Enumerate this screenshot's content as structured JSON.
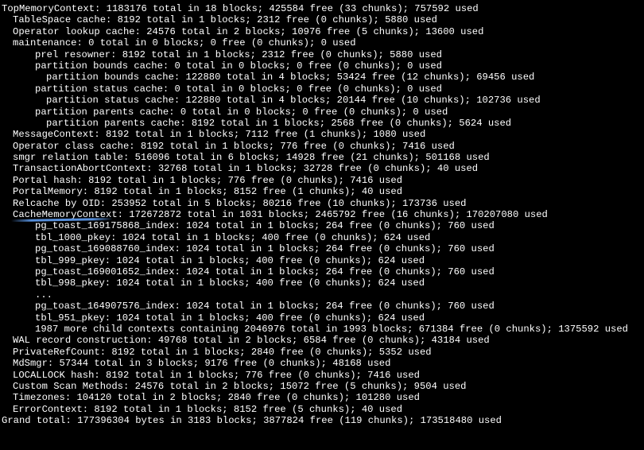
{
  "lines": [
    {
      "indent": 0,
      "text": "TopMemoryContext: 1183176 total in 18 blocks; 425584 free (33 chunks); 757592 used"
    },
    {
      "indent": 1,
      "text": "TableSpace cache: 8192 total in 1 blocks; 2312 free (0 chunks); 5880 used"
    },
    {
      "indent": 1,
      "text": "Operator lookup cache: 24576 total in 2 blocks; 10976 free (5 chunks); 13600 used"
    },
    {
      "indent": 1,
      "text": "maintenance: 0 total in 0 blocks; 0 free (0 chunks); 0 used"
    },
    {
      "indent": 3,
      "text": "prel resowner: 8192 total in 1 blocks; 2312 free (0 chunks); 5880 used"
    },
    {
      "indent": 3,
      "text": "partition bounds cache: 0 total in 0 blocks; 0 free (0 chunks); 0 used"
    },
    {
      "indent": 4,
      "text": "partition bounds cache: 122880 total in 4 blocks; 53424 free (12 chunks); 69456 used"
    },
    {
      "indent": 3,
      "text": "partition status cache: 0 total in 0 blocks; 0 free (0 chunks); 0 used"
    },
    {
      "indent": 4,
      "text": "partition status cache: 122880 total in 4 blocks; 20144 free (10 chunks); 102736 used"
    },
    {
      "indent": 3,
      "text": "partition parents cache: 0 total in 0 blocks; 0 free (0 chunks); 0 used"
    },
    {
      "indent": 4,
      "text": "partition parents cache: 8192 total in 1 blocks; 2568 free (0 chunks); 5624 used"
    },
    {
      "indent": 1,
      "text": "MessageContext: 8192 total in 1 blocks; 7112 free (1 chunks); 1080 used"
    },
    {
      "indent": 1,
      "text": "Operator class cache: 8192 total in 1 blocks; 776 free (0 chunks); 7416 used"
    },
    {
      "indent": 1,
      "text": "smgr relation table: 516096 total in 6 blocks; 14928 free (21 chunks); 501168 used"
    },
    {
      "indent": 1,
      "text": "TransactionAbortContext: 32768 total in 1 blocks; 32728 free (0 chunks); 40 used"
    },
    {
      "indent": 1,
      "text": "Portal hash: 8192 total in 1 blocks; 776 free (0 chunks); 7416 used"
    },
    {
      "indent": 1,
      "text": "PortalMemory: 8192 total in 1 blocks; 8152 free (1 chunks); 40 used"
    },
    {
      "indent": 1,
      "text": "Relcache by OID: 253952 total in 5 blocks; 80216 free (10 chunks); 173736 used"
    },
    {
      "indent": 1,
      "text": "CacheMemoryContext: 172672872 total in 1031 blocks; 2465792 free (16 chunks); 170207080 used",
      "highlight": true
    },
    {
      "indent": 3,
      "text": "pg_toast_169175868_index: 1024 total in 1 blocks; 264 free (0 chunks); 760 used"
    },
    {
      "indent": 3,
      "text": "tbl_1000_pkey: 1024 total in 1 blocks; 400 free (0 chunks); 624 used"
    },
    {
      "indent": 3,
      "text": "pg_toast_169088760_index: 1024 total in 1 blocks; 264 free (0 chunks); 760 used"
    },
    {
      "indent": 3,
      "text": "tbl_999_pkey: 1024 total in 1 blocks; 400 free (0 chunks); 624 used"
    },
    {
      "indent": 3,
      "text": "pg_toast_169001652_index: 1024 total in 1 blocks; 264 free (0 chunks); 760 used"
    },
    {
      "indent": 3,
      "text": "tbl_998_pkey: 1024 total in 1 blocks; 400 free (0 chunks); 624 used"
    },
    {
      "indent": 3,
      "text": "..."
    },
    {
      "indent": 3,
      "text": "pg_toast_164907576_index: 1024 total in 1 blocks; 264 free (0 chunks); 760 used"
    },
    {
      "indent": 3,
      "text": "tbl_951_pkey: 1024 total in 1 blocks; 400 free (0 chunks); 624 used"
    },
    {
      "indent": 3,
      "text": "1987 more child contexts containing 2046976 total in 1993 blocks; 671384 free (0 chunks); 1375592 used"
    },
    {
      "indent": 1,
      "text": "WAL record construction: 49768 total in 2 blocks; 6584 free (0 chunks); 43184 used"
    },
    {
      "indent": 1,
      "text": "PrivateRefCount: 8192 total in 1 blocks; 2840 free (0 chunks); 5352 used"
    },
    {
      "indent": 1,
      "text": "MdSmgr: 57344 total in 3 blocks; 9176 free (0 chunks); 48168 used"
    },
    {
      "indent": 1,
      "text": "LOCALLOCK hash: 8192 total in 1 blocks; 776 free (0 chunks); 7416 used"
    },
    {
      "indent": 1,
      "text": "Custom Scan Methods: 24576 total in 2 blocks; 15072 free (5 chunks); 9504 used"
    },
    {
      "indent": 1,
      "text": "Timezones: 104120 total in 2 blocks; 2840 free (0 chunks); 101280 used"
    },
    {
      "indent": 1,
      "text": "ErrorContext: 8192 total in 1 blocks; 8152 free (5 chunks); 40 used"
    },
    {
      "indent": 0,
      "text": "Grand total: 177396304 bytes in 3183 blocks; 3877824 free (119 chunks); 173518480 used"
    }
  ]
}
